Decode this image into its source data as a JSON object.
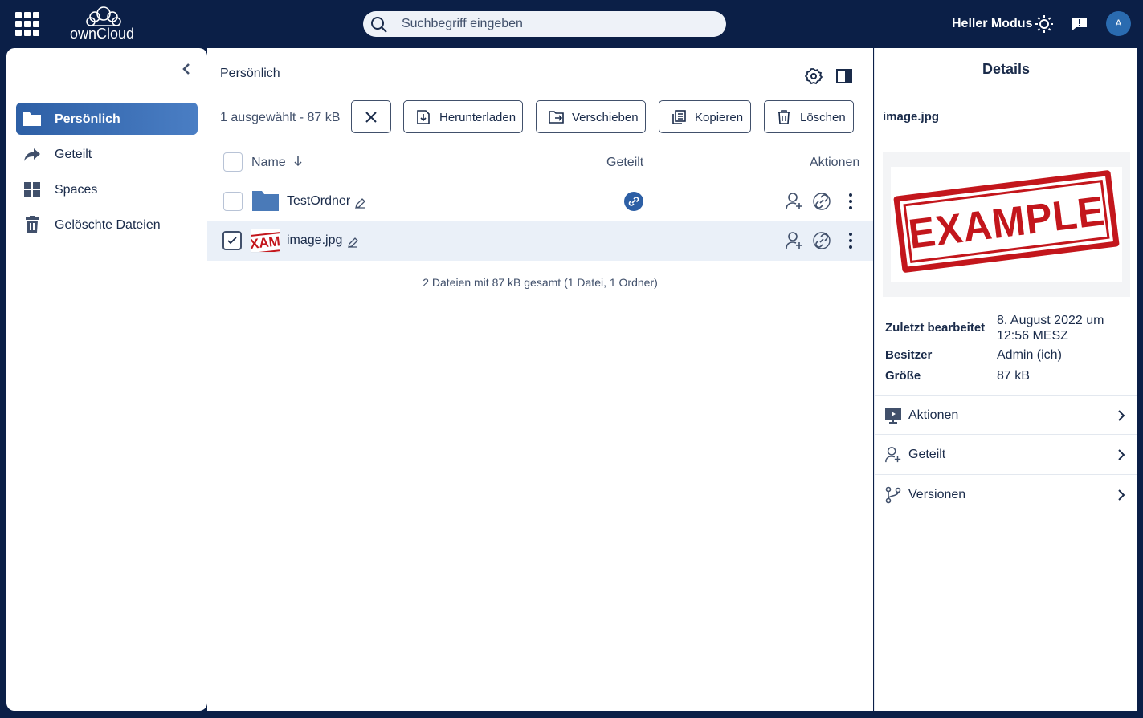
{
  "app": {
    "logo_text": "ownCloud",
    "search_placeholder": "Suchbegriff eingeben",
    "mode_label": "Heller Modus",
    "avatar_initial": "A"
  },
  "sidebar": {
    "items": [
      {
        "label": "Persönlich",
        "icon": "folder-icon",
        "active": true
      },
      {
        "label": "Geteilt",
        "icon": "share-icon",
        "active": false
      },
      {
        "label": "Spaces",
        "icon": "grid-icon",
        "active": false
      },
      {
        "label": "Gelöschte Dateien",
        "icon": "trash-icon",
        "active": false
      }
    ]
  },
  "main": {
    "breadcrumb": "Persönlich",
    "selection_info": "1 ausgewählt - 87 kB",
    "actions": {
      "download": "Herunterladen",
      "move": "Verschieben",
      "copy": "Kopieren",
      "delete": "Löschen"
    },
    "columns": {
      "name": "Name",
      "shared": "Geteilt",
      "actions": "Aktionen"
    },
    "files": [
      {
        "name": "TestOrdner",
        "type": "folder",
        "selected": false,
        "shared_via_link": true
      },
      {
        "name": "image.jpg",
        "type": "image",
        "selected": true,
        "thumb_text": "XAMPL",
        "shared_via_link": false
      }
    ],
    "footer": "2 Dateien mit 87 kB gesamt (1 Datei, 1 Ordner)"
  },
  "details": {
    "title": "Details",
    "file_name": "image.jpg",
    "preview_text": "EXAMPLE",
    "meta": [
      {
        "key": "Zuletzt bearbeitet",
        "value": "8. August 2022 um 12:56 MESZ"
      },
      {
        "key": "Besitzer",
        "value": "Admin (ich)"
      },
      {
        "key": "Größe",
        "value": "87 kB"
      }
    ],
    "panels": [
      {
        "label": "Aktionen",
        "icon": "actions-icon"
      },
      {
        "label": "Geteilt",
        "icon": "add-user-icon"
      },
      {
        "label": "Versionen",
        "icon": "branch-icon"
      }
    ]
  },
  "colors": {
    "topbar": "#0b1f47",
    "accent": "#2d5fa5",
    "stamp_red": "#c3161c",
    "text": "#1a2b4a"
  }
}
